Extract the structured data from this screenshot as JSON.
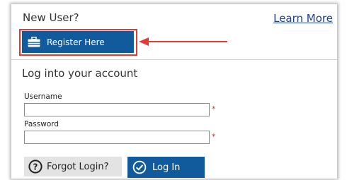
{
  "new_user": {
    "heading": "New User?",
    "learn_more_link": "Learn More",
    "register_button": "Register Here"
  },
  "login": {
    "heading": "Log into your account",
    "username_label": "Username",
    "password_label": "Password",
    "required_marker": "*",
    "forgot_button": "Forgot Login?",
    "login_button": "Log In"
  },
  "icons": {
    "register": "briefcase-icon",
    "forgot": "question-circle-icon",
    "login": "check-circle-icon"
  },
  "colors": {
    "primary_button": "#115a9c",
    "link": "#1f3f91",
    "highlight": "#e53935",
    "required": "#d32f2f",
    "secondary_button": "#e3e3e3"
  }
}
